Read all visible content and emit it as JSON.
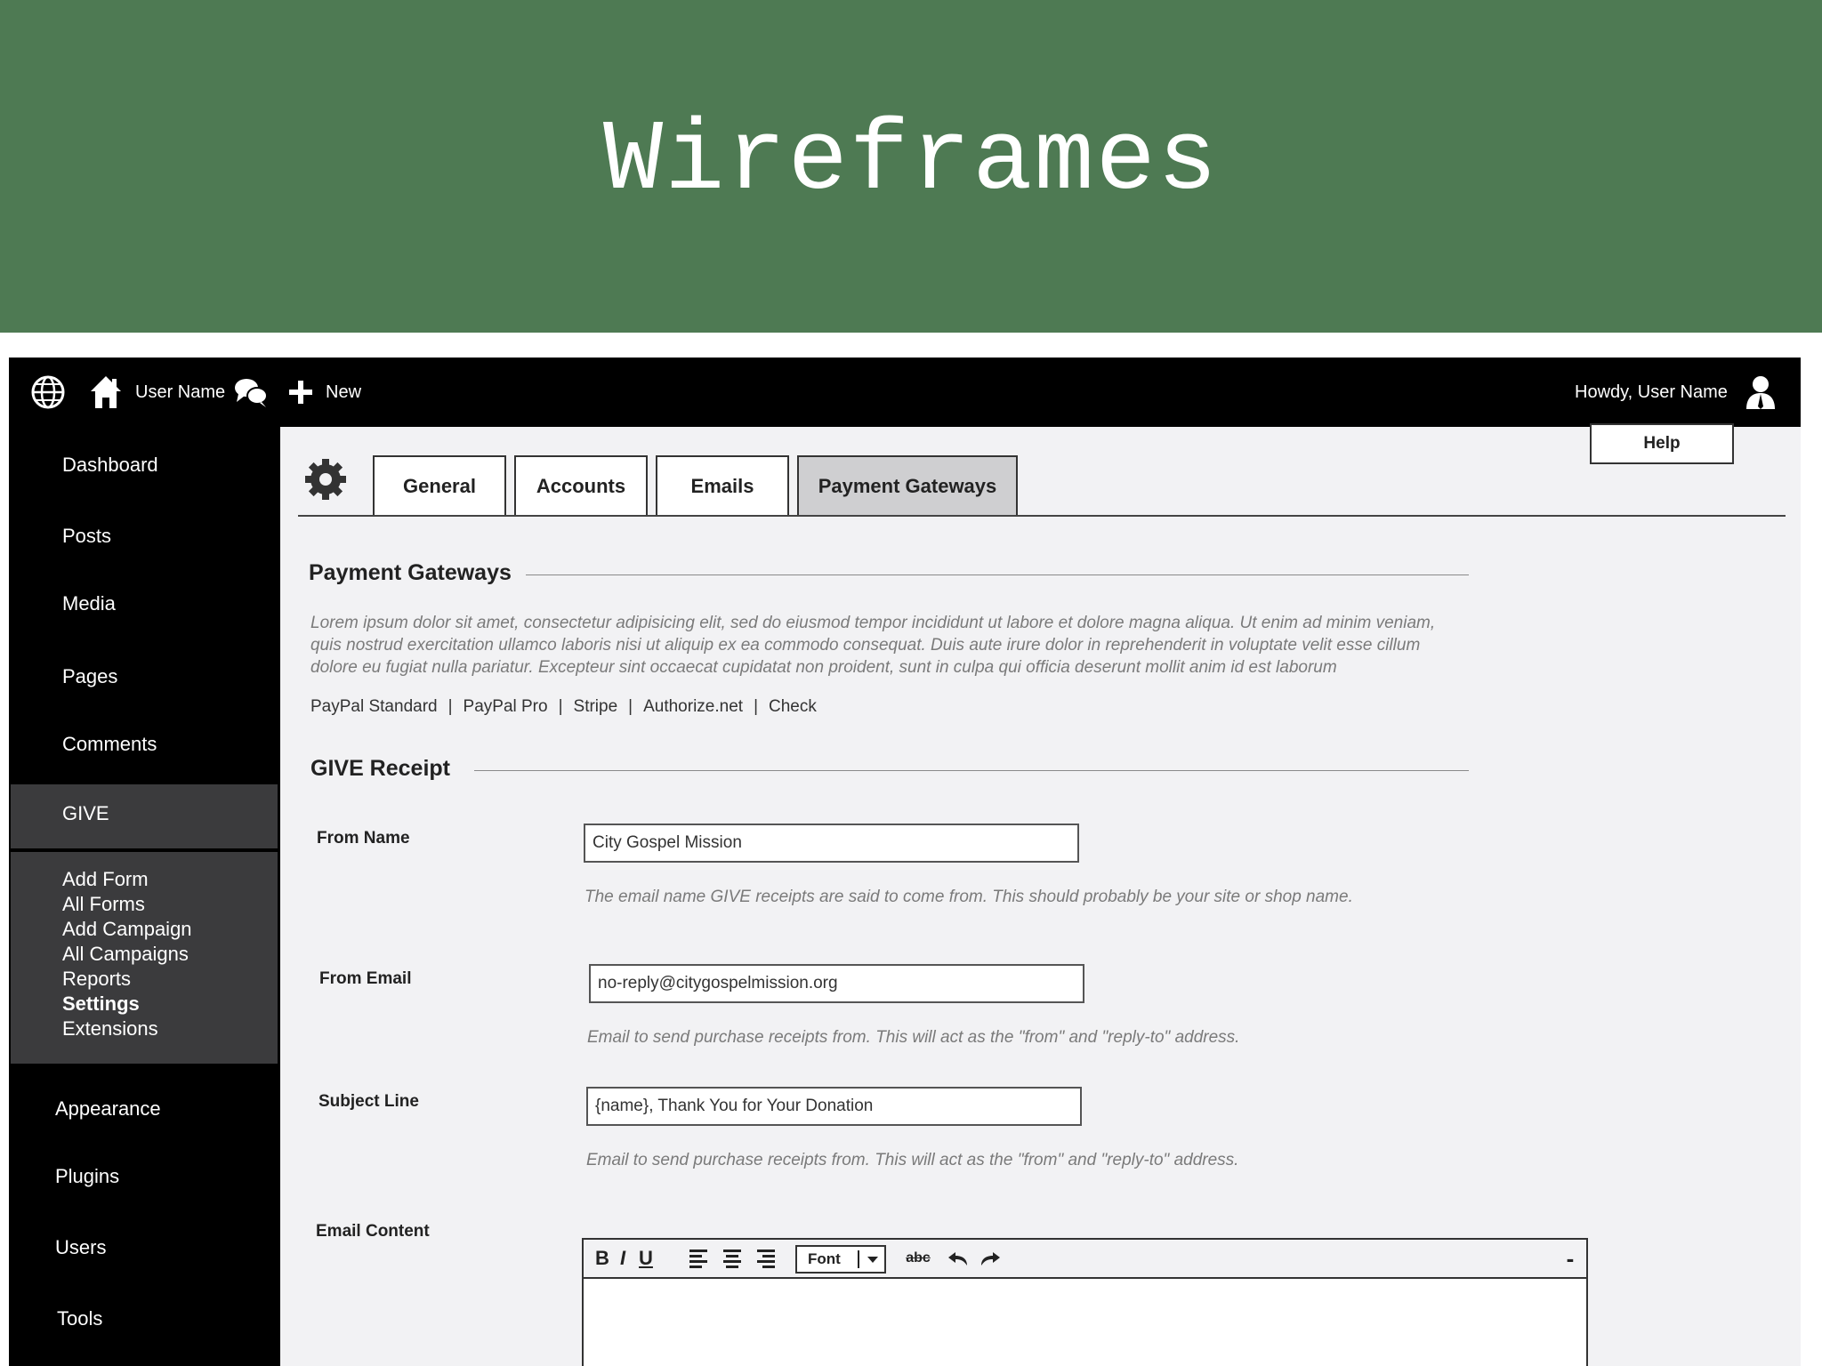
{
  "banner": {
    "title": "Wireframes"
  },
  "topbar": {
    "user_name": "User Name",
    "new_label": "New",
    "howdy": "Howdy, User Name"
  },
  "sidebar": {
    "items_top": [
      "Dashboard",
      "Posts",
      "Media",
      "Pages",
      "Comments"
    ],
    "give": "GIVE",
    "give_sub": [
      "Add Form",
      "All Forms",
      "Add Campaign",
      "All Campaigns",
      "Reports",
      "Settings",
      "Extensions"
    ],
    "active_sub": "Settings",
    "items_bottom": [
      "Appearance",
      "Plugins",
      "Users",
      "Tools"
    ]
  },
  "tabs": [
    "General",
    "Accounts",
    "Emails",
    "Payment Gateways"
  ],
  "active_tab": "Payment Gateways",
  "help_label": "Help",
  "payment_gateways": {
    "title": "Payment Gateways",
    "description": "Lorem ipsum dolor sit amet, consectetur adipisicing elit, sed do eiusmod tempor incididunt ut labore et dolore magna aliqua. Ut enim ad minim veniam, quis nostrud exercitation ullamco laboris nisi ut aliquip ex ea commodo consequat. Duis aute irure dolor in reprehenderit in voluptate velit esse cillum dolore eu fugiat nulla pariatur. Excepteur sint occaecat cupidatat non proident, sunt in culpa qui officia deserunt mollit anim id est laborum",
    "gateways": [
      "PayPal Standard",
      "PayPal Pro",
      "Stripe",
      "Authorize.net",
      "Check"
    ],
    "separator": "|"
  },
  "receipt": {
    "title": "GIVE Receipt",
    "from_name": {
      "label": "From Name",
      "value": "City Gospel Mission",
      "hint": "The email name GIVE receipts are said to come from. This should probably be your site or shop name."
    },
    "from_email": {
      "label": "From Email",
      "value": "no-reply@citygospelmission.org",
      "hint": "Email to send purchase receipts from. This will act as the \"from\" and \"reply-to\" address."
    },
    "subject": {
      "label": "Subject Line",
      "value": "{name}, Thank You for Your Donation",
      "hint": "Email to send purchase receipts from. This will act as the \"from\" and \"reply-to\" address."
    },
    "email_content": {
      "label": "Email Content"
    }
  },
  "editor": {
    "bold": "B",
    "italic": "I",
    "underline": "U",
    "font_label": "Font",
    "strike": "abc",
    "collapse": "-"
  },
  "colors": {
    "banner": "#4e7a53",
    "app_bg": "#000000",
    "content_bg": "#f2f2f4",
    "give_bg": "#3b3b3d",
    "active_tab": "#cfcfd1"
  }
}
